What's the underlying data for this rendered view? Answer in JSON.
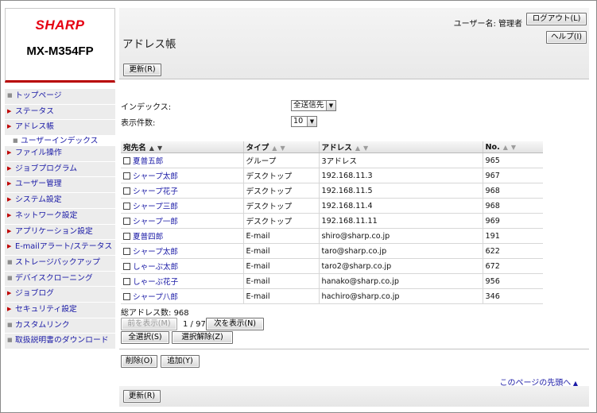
{
  "brand": "SHARP",
  "model": "MX-M354FP",
  "header": {
    "user_prefix": "ユーザー名:",
    "user_name": "管理者",
    "logout_label": "ログアウト(L)",
    "help_label": "ヘルプ(I)",
    "title": "アドレス帳",
    "refresh_label": "更新(R)"
  },
  "nav": [
    {
      "label": "トップページ",
      "marker": "square"
    },
    {
      "label": "ステータス",
      "marker": "triangle"
    },
    {
      "label": "アドレス帳",
      "marker": "triangle"
    },
    {
      "label": "ユーザーインデックス",
      "marker": "square",
      "sub": true
    },
    {
      "label": "ファイル操作",
      "marker": "triangle"
    },
    {
      "label": "ジョブプログラム",
      "marker": "triangle"
    },
    {
      "label": "ユーザー管理",
      "marker": "triangle"
    },
    {
      "label": "システム設定",
      "marker": "triangle"
    },
    {
      "label": "ネットワーク設定",
      "marker": "triangle"
    },
    {
      "label": "アプリケーション設定",
      "marker": "triangle"
    },
    {
      "label": "E-mailアラート/ステータス",
      "marker": "triangle"
    },
    {
      "label": "ストレージバックアップ",
      "marker": "square"
    },
    {
      "label": "デバイスクローニング",
      "marker": "square"
    },
    {
      "label": "ジョブログ",
      "marker": "triangle"
    },
    {
      "label": "セキュリティ設定",
      "marker": "triangle"
    },
    {
      "label": "カスタムリンク",
      "marker": "square"
    },
    {
      "label": "取扱説明書のダウンロード",
      "marker": "square"
    }
  ],
  "filters": {
    "index_label": "インデックス:",
    "index_value": "全送信先",
    "count_label": "表示件数:",
    "count_value": "10"
  },
  "table": {
    "columns": [
      "宛先名",
      "タイプ",
      "アドレス",
      "No."
    ],
    "rows": [
      {
        "name": "夏普五郎",
        "type": "グループ",
        "address": "3アドレス",
        "no": "965"
      },
      {
        "name": "シャープ太郎",
        "type": "デスクトップ",
        "address": "192.168.11.3",
        "no": "967"
      },
      {
        "name": "シャープ花子",
        "type": "デスクトップ",
        "address": "192.168.11.5",
        "no": "968"
      },
      {
        "name": "シャープ三郎",
        "type": "デスクトップ",
        "address": "192.168.11.4",
        "no": "968"
      },
      {
        "name": "シャープ一郎",
        "type": "デスクトップ",
        "address": "192.168.11.11",
        "no": "969"
      },
      {
        "name": "夏普四郎",
        "type": "E-mail",
        "address": "shiro@sharp.co.jp",
        "no": "191"
      },
      {
        "name": "シャープ太郎",
        "type": "E-mail",
        "address": "taro@sharp.co.jp",
        "no": "622"
      },
      {
        "name": "しゃーぷ太郎",
        "type": "E-mail",
        "address": "taro2@sharp.co.jp",
        "no": "672"
      },
      {
        "name": "しゃーぷ花子",
        "type": "E-mail",
        "address": "hanako@sharp.co.jp",
        "no": "956"
      },
      {
        "name": "シャープ八郎",
        "type": "E-mail",
        "address": "hachiro@sharp.co.jp",
        "no": "346"
      }
    ]
  },
  "footer": {
    "total_label": "総アドレス数:",
    "total_value": "968",
    "prev_label": "前を表示(M)",
    "page_indicator": "1 / 97",
    "next_label": "次を表示(N)",
    "select_all_label": "全選択(S)",
    "deselect_label": "選択解除(Z)",
    "delete_label": "削除(O)",
    "add_label": "追加(Y)",
    "top_link": "このページの先頭へ",
    "refresh_label": "更新(R)"
  },
  "colors": {
    "brand_red": "#e60012",
    "link_blue": "#1a1aa6",
    "nav_bg": "#ececec"
  }
}
